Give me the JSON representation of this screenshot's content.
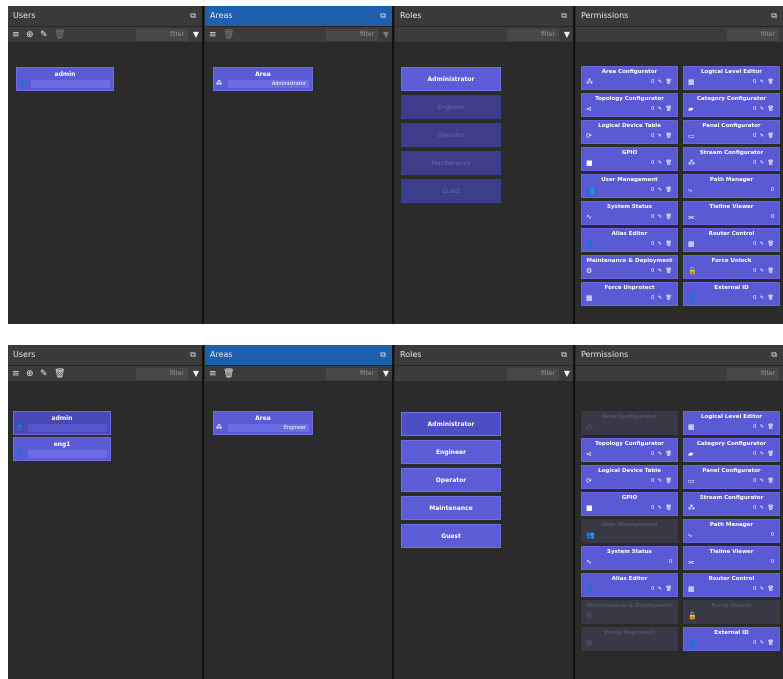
{
  "panels": {
    "users": "Users",
    "areas": "Areas",
    "roles": "Roles",
    "permissions": "Permissions"
  },
  "toolbar": {
    "filter_placeholder": "filter",
    "popout_icon": "popout-icon",
    "list_icon": "list-icon",
    "add_icon": "add-icon",
    "edit_icon": "edit-icon",
    "delete_icon": "trash-icon",
    "filter_icon": "funnel-icon"
  },
  "colors": {
    "panel_bg": "#2b2b2b",
    "header_bg": "#3a3a3a",
    "active_header": "#1e5fae",
    "card": "#5b5bd6",
    "card_dim": "#3d3d8a",
    "perm_dim": "#393945"
  },
  "top": {
    "users": [
      {
        "name": "admin",
        "detail": ""
      }
    ],
    "area": {
      "title": "Area",
      "value": "Administrator"
    },
    "roles": [
      {
        "label": "Administrator",
        "active": true
      },
      {
        "label": "Engineer",
        "active": false
      },
      {
        "label": "Operator",
        "active": false
      },
      {
        "label": "Maintenance",
        "active": false
      },
      {
        "label": "Guest",
        "active": false
      }
    ],
    "permissions": [
      {
        "label": "Area Configurator",
        "icon": "sitemap-icon",
        "actions": "0 ✎ 🗑",
        "enabled": true
      },
      {
        "label": "Logical Level Editor",
        "icon": "grid-icon",
        "actions": "0 ✎ 🗑",
        "enabled": true
      },
      {
        "label": "Topology Configurator",
        "icon": "share-icon",
        "actions": "0 ✎ 🗑",
        "enabled": true
      },
      {
        "label": "Category Configurator",
        "icon": "folder-icon",
        "actions": "0 ✎ 🗑",
        "enabled": true
      },
      {
        "label": "Logical Device Table",
        "icon": "refresh-icon",
        "actions": "0 ✎ 🗑",
        "enabled": true
      },
      {
        "label": "Panel Configurator",
        "icon": "panel-icon",
        "actions": "0 ✎ 🗑",
        "enabled": true
      },
      {
        "label": "GPIO",
        "icon": "square-icon",
        "actions": "0 ✎ 🗑",
        "enabled": true
      },
      {
        "label": "Stream Configurator",
        "icon": "sitemap-icon",
        "actions": "0 ✎ 🗑",
        "enabled": true
      },
      {
        "label": "User Management",
        "icon": "users-icon",
        "actions": "0 ✎ 🗑",
        "enabled": true
      },
      {
        "label": "Path Manager",
        "icon": "path-icon",
        "actions": "0",
        "enabled": true
      },
      {
        "label": "System Status",
        "icon": "pulse-icon",
        "actions": "0 ✎ 🗑",
        "enabled": true
      },
      {
        "label": "Tieline Viewer",
        "icon": "tieline-icon",
        "actions": "0",
        "enabled": true
      },
      {
        "label": "Alias Editor",
        "icon": "user-tag-icon",
        "actions": "0 ✎ 🗑",
        "enabled": true
      },
      {
        "label": "Router Control",
        "icon": "grid-icon",
        "actions": "0 ✎ 🗑",
        "enabled": true
      },
      {
        "label": "Maintenance & Deployment",
        "icon": "gear-icon",
        "actions": "0 ✎ 🗑",
        "enabled": true
      },
      {
        "label": "Force Unlock",
        "icon": "unlock-icon",
        "actions": "0 ✎ 🗑",
        "enabled": true
      },
      {
        "label": "Force Unprotect",
        "icon": "grid-icon",
        "actions": "0 ✎ 🗑",
        "enabled": true
      },
      {
        "label": "External ID",
        "icon": "user-tag-icon",
        "actions": "0 ✎ 🗑",
        "enabled": true
      }
    ]
  },
  "bottom": {
    "users": [
      {
        "name": "admin",
        "detail": ""
      },
      {
        "name": "eng1",
        "detail": ""
      }
    ],
    "area": {
      "title": "Area",
      "value": "Engineer"
    },
    "roles": [
      {
        "label": "Administrator",
        "active": true
      },
      {
        "label": "Engineer",
        "active": true
      },
      {
        "label": "Operator",
        "active": true
      },
      {
        "label": "Maintenance",
        "active": true
      },
      {
        "label": "Guest",
        "active": true
      }
    ],
    "permissions": [
      {
        "label": "Area Configurator",
        "icon": "sitemap-icon",
        "actions": "",
        "enabled": false
      },
      {
        "label": "Logical Level Editor",
        "icon": "grid-icon",
        "actions": "0 ✎ 🗑",
        "enabled": true
      },
      {
        "label": "Topology Configurator",
        "icon": "share-icon",
        "actions": "0 ✎ 🗑",
        "enabled": true
      },
      {
        "label": "Category Configurator",
        "icon": "folder-icon",
        "actions": "0 ✎ 🗑",
        "enabled": true
      },
      {
        "label": "Logical Device Table",
        "icon": "refresh-icon",
        "actions": "0 ✎ 🗑",
        "enabled": true
      },
      {
        "label": "Panel Configurator",
        "icon": "panel-icon",
        "actions": "0 ✎ 🗑",
        "enabled": true
      },
      {
        "label": "GPIO",
        "icon": "square-icon",
        "actions": "0 ✎ 🗑",
        "enabled": true
      },
      {
        "label": "Stream Configurator",
        "icon": "sitemap-icon",
        "actions": "0 ✎ 🗑",
        "enabled": true
      },
      {
        "label": "User Management",
        "icon": "users-icon",
        "actions": "",
        "enabled": false
      },
      {
        "label": "Path Manager",
        "icon": "path-icon",
        "actions": "0",
        "enabled": true
      },
      {
        "label": "System Status",
        "icon": "pulse-icon",
        "actions": "0",
        "enabled": true
      },
      {
        "label": "Tieline Viewer",
        "icon": "tieline-icon",
        "actions": "0",
        "enabled": true
      },
      {
        "label": "Alias Editor",
        "icon": "user-tag-icon",
        "actions": "0 ✎ 🗑",
        "enabled": true
      },
      {
        "label": "Router Control",
        "icon": "grid-icon",
        "actions": "0 ✎ 🗑",
        "enabled": true
      },
      {
        "label": "Maintenance & Deployment",
        "icon": "gear-icon",
        "actions": "",
        "enabled": false
      },
      {
        "label": "Force Unlock",
        "icon": "unlock-icon",
        "actions": "",
        "enabled": false
      },
      {
        "label": "Force Unprotect",
        "icon": "grid-icon",
        "actions": "",
        "enabled": false
      },
      {
        "label": "External ID",
        "icon": "user-tag-icon",
        "actions": "0 ✎ 🗑",
        "enabled": true
      }
    ]
  }
}
